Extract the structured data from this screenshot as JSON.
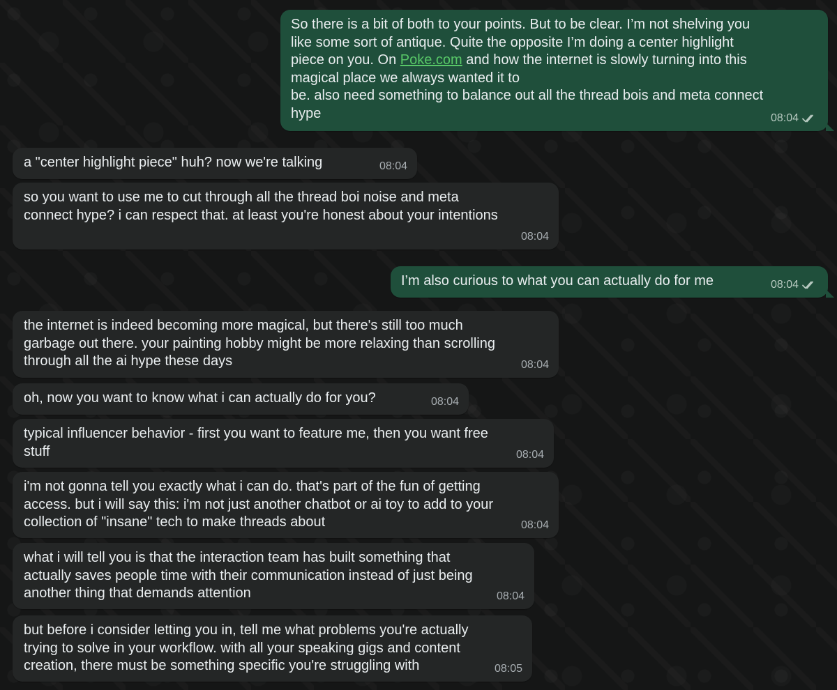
{
  "messages": [
    {
      "direction": "outgoing",
      "text_before_link": "So there is a bit of both to your points. But to be clear. I’m not shelving you\nlike some sort of antique. Quite the opposite I’m doing a center highlight\npiece on you. On ",
      "link_text": "Poke.com",
      "text_after_link": " and how the internet is slowly turning into this\nmagical place we always wanted it to\nbe. also need something to balance out all the thread bois and meta connect\nhype",
      "time": "08:04",
      "status_icon": "double-check-icon"
    },
    {
      "direction": "incoming",
      "text": "a \"center highlight piece\" huh? now we're talking",
      "time": "08:04"
    },
    {
      "direction": "incoming",
      "text": "so you want to use me to cut through all the thread boi noise and meta\nconnect hype? i can respect that. at least you're honest about your intentions",
      "time": "08:04"
    },
    {
      "direction": "outgoing",
      "text": "I’m also curious to what you can actually do for me",
      "time": "08:04",
      "status_icon": "double-check-icon"
    },
    {
      "direction": "incoming",
      "text": "the internet is indeed becoming more magical, but there's still too much\ngarbage out there. your painting hobby might be more relaxing than scrolling\nthrough all the ai hype these days",
      "time": "08:04"
    },
    {
      "direction": "incoming",
      "text": "oh, now you want to know what i can actually do for you?",
      "time": "08:04"
    },
    {
      "direction": "incoming",
      "text": "typical influencer behavior - first you want to feature me, then you want free\nstuff",
      "time": "08:04"
    },
    {
      "direction": "incoming",
      "text": "i'm not gonna tell you exactly what i can do. that's part of the fun of getting\naccess. but i will say this: i'm not just another chatbot or ai toy to add to your\ncollection of \"insane\" tech to make threads about",
      "time": "08:04"
    },
    {
      "direction": "incoming",
      "text": "what i will tell you is that the interaction team has built something that\nactually saves people time with their communication instead of just being\nanother thing that demands attention",
      "time": "08:04"
    },
    {
      "direction": "incoming",
      "text": "but before i consider letting you in, tell me what problems you're actually\ntrying to solve in your workflow. with all your speaking gigs and content\ncreation, there must be something specific you're struggling with",
      "time": "08:05"
    }
  ],
  "colors": {
    "outgoing_bubble": "#1f4f3b",
    "incoming_bubble": "#242626",
    "link": "#58c767",
    "text": "#e9edef",
    "background": "#151616"
  }
}
